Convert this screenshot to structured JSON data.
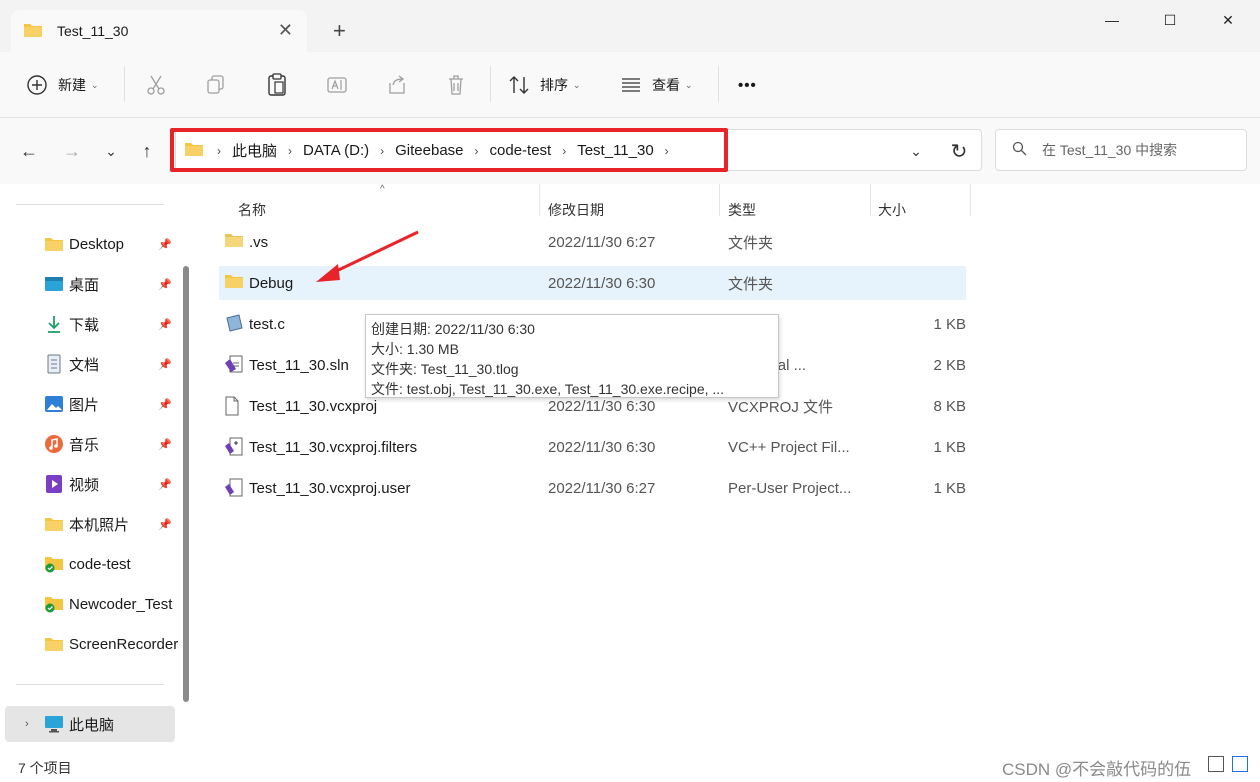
{
  "window": {
    "tab_title": "Test_11_30",
    "close_tab": "✕",
    "new_tab": "+",
    "minimize": "—",
    "maximize": "☐",
    "close": "✕"
  },
  "toolbar": {
    "new_label": "新建",
    "sort_label": "排序",
    "view_label": "查看",
    "more": "•••",
    "dropdown": "⌄"
  },
  "nav": {
    "back": "←",
    "forward": "→",
    "recent": "⌄",
    "up": "↑",
    "expand": "⌄",
    "refresh": "↻"
  },
  "breadcrumb": [
    "此电脑",
    "DATA (D:)",
    "Giteebase",
    "code-test",
    "Test_11_30"
  ],
  "search": {
    "placeholder": "在 Test_11_30 中搜索"
  },
  "sidebar": {
    "items": [
      {
        "label": "Desktop",
        "icon": "folder-icon",
        "pinned": true
      },
      {
        "label": "桌面",
        "icon": "desktop-icon",
        "pinned": true
      },
      {
        "label": "下载",
        "icon": "download-icon",
        "pinned": true
      },
      {
        "label": "文档",
        "icon": "document-icon",
        "pinned": true
      },
      {
        "label": "图片",
        "icon": "picture-icon",
        "pinned": true
      },
      {
        "label": "音乐",
        "icon": "music-icon",
        "pinned": true
      },
      {
        "label": "视频",
        "icon": "video-icon",
        "pinned": true
      },
      {
        "label": "本机照片",
        "icon": "folder-icon",
        "pinned": true
      },
      {
        "label": "code-test",
        "icon": "synced-folder-icon",
        "pinned": false
      },
      {
        "label": "Newcoder_Test",
        "icon": "synced-folder-icon",
        "pinned": false
      },
      {
        "label": "ScreenRecorder",
        "icon": "folder-icon",
        "pinned": false
      }
    ],
    "this_pc": "此电脑",
    "pin_glyph": "📌",
    "chevron": "›"
  },
  "columns": {
    "name": "名称",
    "date": "修改日期",
    "type": "类型",
    "size": "大小"
  },
  "files": [
    {
      "name": ".vs",
      "date": "2022/11/30 6:27",
      "type": "文件夹",
      "size": "",
      "icon": "folder-icon"
    },
    {
      "name": "Debug",
      "date": "2022/11/30 6:30",
      "type": "文件夹",
      "size": "",
      "icon": "folder-icon"
    },
    {
      "name": "test.c",
      "date": "",
      "type": "",
      "size": "1 KB",
      "icon": "c-file-icon"
    },
    {
      "name": "Test_11_30.sln",
      "date": "",
      "type": "oft Visual ...",
      "size": "2 KB",
      "icon": "sln-file-icon"
    },
    {
      "name": "Test_11_30.vcxproj",
      "date": "2022/11/30 6:30",
      "type": "VCXPROJ 文件",
      "size": "8 KB",
      "icon": "file-icon"
    },
    {
      "name": "Test_11_30.vcxproj.filters",
      "date": "2022/11/30 6:30",
      "type": "VC++ Project Fil...",
      "size": "1 KB",
      "icon": "filters-file-icon"
    },
    {
      "name": "Test_11_30.vcxproj.user",
      "date": "2022/11/30 6:27",
      "type": "Per-User Project...",
      "size": "1 KB",
      "icon": "user-file-icon"
    }
  ],
  "tooltip": {
    "line1": "创建日期: 2022/11/30 6:30",
    "line2": "大小: 1.30 MB",
    "line3": "文件夹: Test_11_30.tlog",
    "line4": "文件: test.obj, Test_11_30.exe, Test_11_30.exe.recipe, ..."
  },
  "status": {
    "count": "7 个项目"
  },
  "watermark": "CSDN @不会敲代码的伍",
  "colors": {
    "highlight": "#e8232a",
    "selection": "#e7f3fc",
    "folder": "#f4c542"
  }
}
